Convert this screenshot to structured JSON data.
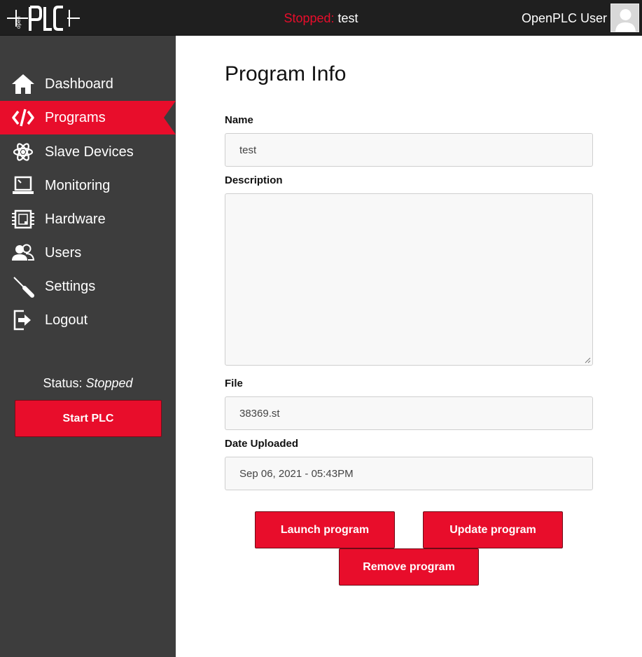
{
  "app": {
    "logo_text": "openPLC"
  },
  "topbar": {
    "status_prefix": "Stopped:",
    "program_name": "test",
    "user_name": "OpenPLC User",
    "accent_color": "#e80d2b"
  },
  "sidebar": {
    "items": [
      {
        "label": "Dashboard",
        "icon": "home-icon"
      },
      {
        "label": "Programs",
        "icon": "code-icon",
        "active": true
      },
      {
        "label": "Slave Devices",
        "icon": "network-icon"
      },
      {
        "label": "Monitoring",
        "icon": "monitor-icon"
      },
      {
        "label": "Hardware",
        "icon": "chip-icon"
      },
      {
        "label": "Users",
        "icon": "users-icon"
      },
      {
        "label": "Settings",
        "icon": "screwdriver-icon"
      },
      {
        "label": "Logout",
        "icon": "logout-icon"
      }
    ],
    "status_label": "Status:",
    "status_value": "Stopped",
    "start_button": "Start PLC"
  },
  "main": {
    "title": "Program Info",
    "fields": {
      "name_label": "Name",
      "name_value": "test",
      "description_label": "Description",
      "description_value": "",
      "file_label": "File",
      "file_value": "38369.st",
      "date_label": "Date Uploaded",
      "date_value": "Sep 06, 2021 - 05:43PM"
    },
    "buttons": {
      "launch": "Launch program",
      "update": "Update program",
      "remove": "Remove program"
    }
  }
}
